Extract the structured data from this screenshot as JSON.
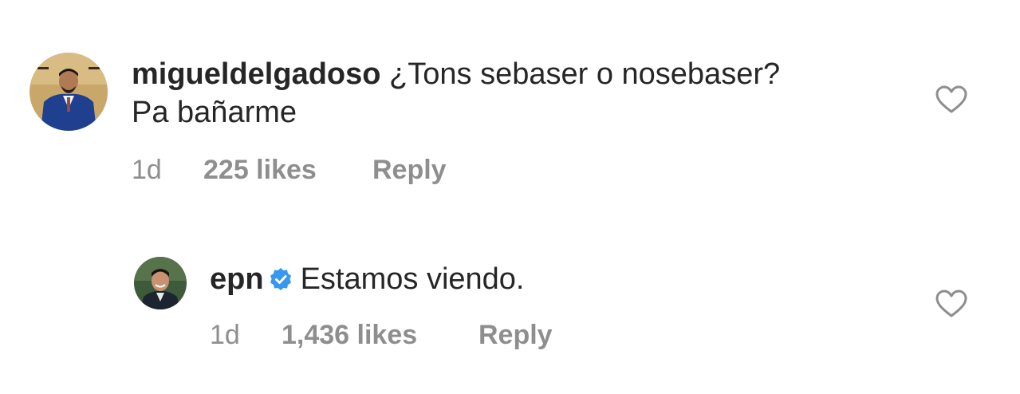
{
  "comments": [
    {
      "username": "migueldelgadoso",
      "text_line1": "¿Tons sebaser o nosebaser?",
      "text_line2": "Pa bañarme",
      "time": "1d",
      "likes": "225 likes",
      "reply": "Reply",
      "avatar_icon": "profile-photo-man-blue-suit",
      "verified": false
    },
    {
      "username": "epn",
      "text_line1": "Estamos viendo.",
      "time": "1d",
      "likes": "1,436 likes",
      "reply": "Reply",
      "avatar_icon": "profile-photo-man-smiling",
      "verified": true
    }
  ],
  "icons": {
    "like": "heart-outline-icon",
    "verified": "verified-badge-icon"
  },
  "colors": {
    "text": "#262626",
    "secondary": "#8e8e8e",
    "verified_blue": "#3897f0",
    "heart_stroke": "#8e8e8e"
  }
}
